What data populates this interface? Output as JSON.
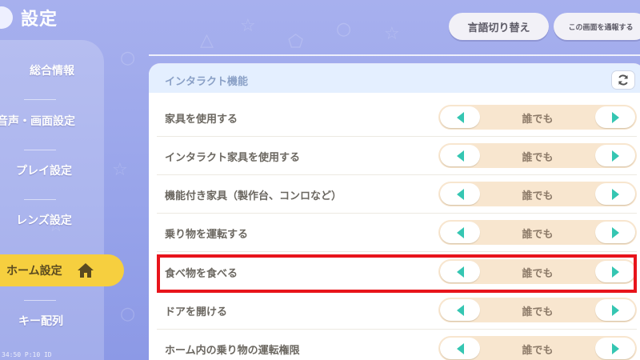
{
  "header": {
    "title": "設定",
    "lang_button": "言語切り替え",
    "report_button": "この画面を通報する"
  },
  "sidebar": {
    "items": [
      {
        "label": "総合情報"
      },
      {
        "label": "音声・画面設定"
      },
      {
        "label": "プレイ設定"
      },
      {
        "label": "レンズ設定"
      },
      {
        "label": "ホーム設定"
      },
      {
        "label": "キー配列"
      }
    ],
    "active_index": 4
  },
  "panel": {
    "title": "インタラクト機能",
    "rows": [
      {
        "label": "家具を使用する",
        "value": "誰でも"
      },
      {
        "label": "インタラクト家具を使用する",
        "value": "誰でも"
      },
      {
        "label": "機能付き家具（製作台、コンロなど）",
        "value": "誰でも"
      },
      {
        "label": "乗り物を運転する",
        "value": "誰でも"
      },
      {
        "label": "食べ物を食べる",
        "value": "誰でも"
      },
      {
        "label": "ドアを開ける",
        "value": "誰でも"
      },
      {
        "label": "ホーム内の乗り物の運転権限",
        "value": "誰でも"
      }
    ],
    "highlighted_row": 4
  },
  "debug_text": "34:50 P:10 ID",
  "colors": {
    "background": "#9aa6ea",
    "active_tab": "#f6cf3f",
    "stepper_bg": "#f8e6cf",
    "arrow": "#35c6b2",
    "highlight": "#e8141b"
  },
  "icons": {
    "refresh": "refresh-icon",
    "home": "home-icon"
  }
}
